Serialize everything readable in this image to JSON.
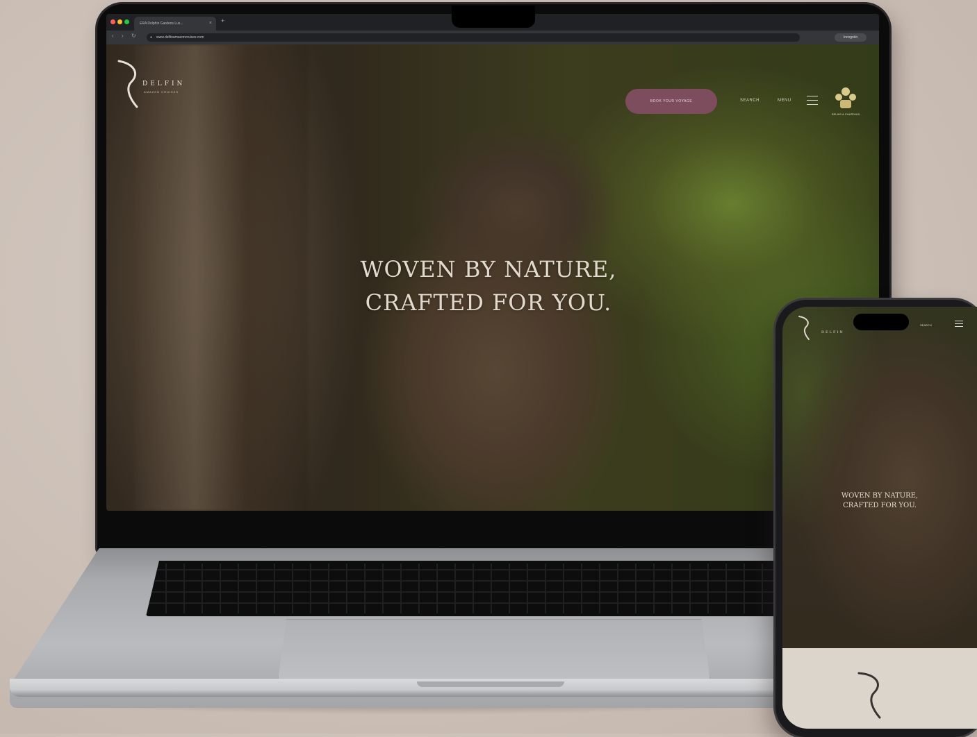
{
  "desktop": {
    "browser": {
      "tab_title": "ERA Dolphin Gardens Lux...",
      "tab_close": "×",
      "new_tab": "+",
      "url": "www.delfinamazoncruises.com",
      "profile_label": "Incognito"
    },
    "site": {
      "logo": {
        "name": "DELFIN",
        "tagline": "AMAZON CRUISES"
      },
      "book_button": "BOOK YOUR VOYAGE",
      "nav": {
        "search": "SEARCH",
        "menu": "MENU"
      },
      "crest_text": "RELAIS & CHATEAUX",
      "hero": {
        "line1": "WOVEN BY NATURE,",
        "line2": "CRAFTED FOR YOU."
      }
    }
  },
  "mobile": {
    "logo": {
      "name": "DELFIN"
    },
    "search": "SEARCH",
    "hero": {
      "line1": "WOVEN BY NATURE,",
      "line2": "CRAFTED FOR YOU."
    }
  },
  "colors": {
    "background": "#cbbfb6",
    "book_button": "#7d4d5e",
    "hero_text": "#e2dacd",
    "phone_footer": "#dcd5cc"
  },
  "icons": [
    "menu-icon",
    "logo-swirl-icon",
    "crest-icon",
    "lock-icon",
    "back-icon",
    "forward-icon",
    "reload-icon"
  ]
}
